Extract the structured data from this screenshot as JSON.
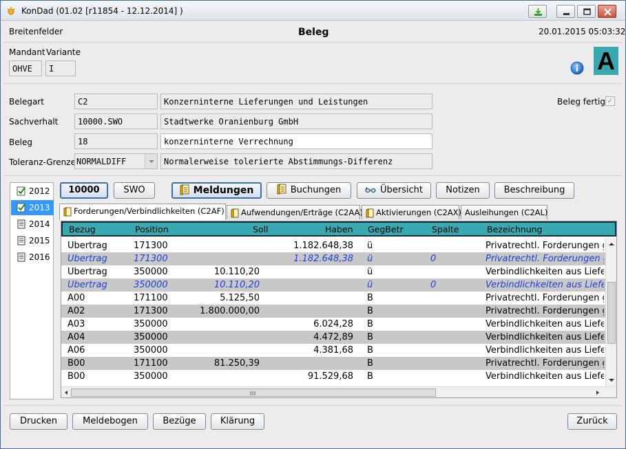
{
  "window": {
    "title": "KonDad (01.02 [r11854 - 12.12.2014] )"
  },
  "header": {
    "left": "Breitenfelder",
    "center": "Beleg",
    "right": "20.01.2015 05:03:32"
  },
  "mandant": {
    "label": "Mandant",
    "value": "OHVE",
    "variante_label": "Variante",
    "variante_value": "I",
    "badge": "A"
  },
  "form": {
    "belegart_label": "Belegart",
    "belegart_code": "C2",
    "belegart_text": "Konzerninterne Lieferungen und Leistungen",
    "sachverhalt_label": "Sachverhalt",
    "sachverhalt_code": "10000.SWO",
    "sachverhalt_text": "Stadtwerke Oranienburg GmbH",
    "beleg_label": "Beleg",
    "beleg_code": "18",
    "beleg_text": "konzerninterne Verrechnung",
    "toleranz_label": "Toleranz-Grenze",
    "toleranz_code": "NORMALDIFF",
    "toleranz_text": "Normalerweise tolerierte Abstimmungs-Differenz",
    "fertig_label": "Beleg fertig",
    "fertig_checked": "✓"
  },
  "years": [
    "2012",
    "2013",
    "2014",
    "2015",
    "2016"
  ],
  "toolbar": {
    "btn_10000": "10000",
    "btn_swo": "SWO",
    "meldungen": "Meldungen",
    "buchungen": "Buchungen",
    "uebersicht": "Übersicht",
    "notizen": "Notizen",
    "beschreibung": "Beschreibung"
  },
  "tabs": [
    "Forderungen/Verbindlichkeiten (C2AF)",
    "Aufwendungen/Erträge (C2AA)",
    "Aktivierungen (C2AX)",
    "Ausleihungen (C2AL)"
  ],
  "table": {
    "headers": [
      "Bezug",
      "Position",
      "Soll",
      "Haben",
      "GegBetr",
      "Spalte",
      "Bezeichnung"
    ],
    "rows": [
      {
        "bezug": "Übertrag",
        "position": "171300",
        "soll": "",
        "haben": "1.182.648,38",
        "geg": "ü",
        "spalte": "",
        "bez": "Privatrechtl. Forderungen g",
        "style": "normal"
      },
      {
        "bezug": "Übertrag",
        "position": "171300",
        "soll": "",
        "haben": "1.182.648,38",
        "geg": "ü",
        "spalte": "0",
        "bez": "Privatrechtl. Forderungen g",
        "style": "blue"
      },
      {
        "bezug": "Übertrag",
        "position": "350000",
        "soll": "10.110,20",
        "haben": "",
        "geg": "ü",
        "spalte": "",
        "bez": "Verbindlichkeiten aus Liefe",
        "style": "normal"
      },
      {
        "bezug": "Übertrag",
        "position": "350000",
        "soll": "10.110,20",
        "haben": "",
        "geg": "ü",
        "spalte": "0",
        "bez": "Verbindlichkeiten aus Liefe",
        "style": "blue"
      },
      {
        "bezug": "A00",
        "position": "171100",
        "soll": "5.125,50",
        "haben": "",
        "geg": "B",
        "spalte": "",
        "bez": "Privatrechtl. Forderungen g",
        "style": "normal"
      },
      {
        "bezug": "A02",
        "position": "171300",
        "soll": "1.800.000,00",
        "haben": "",
        "geg": "B",
        "spalte": "",
        "bez": "Privatrechtl. Forderungen g",
        "style": "alt"
      },
      {
        "bezug": "A03",
        "position": "350000",
        "soll": "",
        "haben": "6.024,28",
        "geg": "B",
        "spalte": "",
        "bez": "Verbindlichkeiten aus Liefe",
        "style": "normal"
      },
      {
        "bezug": "A04",
        "position": "350000",
        "soll": "",
        "haben": "4.472,89",
        "geg": "B",
        "spalte": "",
        "bez": "Verbindlichkeiten aus Liefe",
        "style": "alt"
      },
      {
        "bezug": "A06",
        "position": "350000",
        "soll": "",
        "haben": "4.381,68",
        "geg": "B",
        "spalte": "",
        "bez": "Verbindlichkeiten aus Liefe",
        "style": "normal"
      },
      {
        "bezug": "B00",
        "position": "171100",
        "soll": "81.250,39",
        "haben": "",
        "geg": "B",
        "spalte": "",
        "bez": "Privatrechtl. Forderungen g",
        "style": "alt"
      },
      {
        "bezug": "B00",
        "position": "350000",
        "soll": "",
        "haben": "91.529,68",
        "geg": "B",
        "spalte": "",
        "bez": "Verbindlichkeiten aus Liefe",
        "style": "normal"
      }
    ]
  },
  "footer": {
    "drucken": "Drucken",
    "meldebogen": "Meldebogen",
    "bezuege": "Bezüge",
    "klaerung": "Klärung",
    "zurueck": "Zurück"
  },
  "icons": {
    "app": "sun-icon",
    "info": "info-icon",
    "document": "document-icon",
    "check_doc": "checked-document-icon"
  },
  "colors": {
    "header_bg": "#3aa8b0",
    "selection": "#3399ff",
    "italic_blue": "#1f3fd8",
    "row_alt": "#c8c8c8"
  }
}
